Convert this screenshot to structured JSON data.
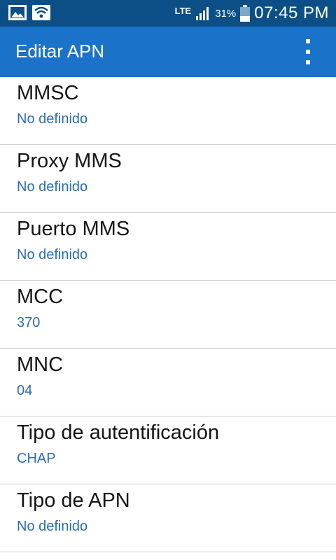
{
  "status_bar": {
    "network_type": "LTE",
    "battery_percent": "31%",
    "time": "07:45 PM",
    "icons": [
      "image-icon",
      "wifi-icon",
      "signal-icon",
      "battery-icon"
    ]
  },
  "app_bar": {
    "title": "Editar APN",
    "overflow_icon": "more-vert-icon"
  },
  "settings": [
    {
      "title": "MMSC",
      "value": "No definido"
    },
    {
      "title": "Proxy MMS",
      "value": "No definido"
    },
    {
      "title": "Puerto MMS",
      "value": "No definido"
    },
    {
      "title": "MCC",
      "value": "370"
    },
    {
      "title": "MNC",
      "value": "04"
    },
    {
      "title": "Tipo de autentificación",
      "value": "CHAP"
    },
    {
      "title": "Tipo de APN",
      "value": "No definido"
    }
  ],
  "colors": {
    "status_bar": "#0b4f86",
    "app_bar": "#1a73c9",
    "value_text": "#2a6db5"
  }
}
